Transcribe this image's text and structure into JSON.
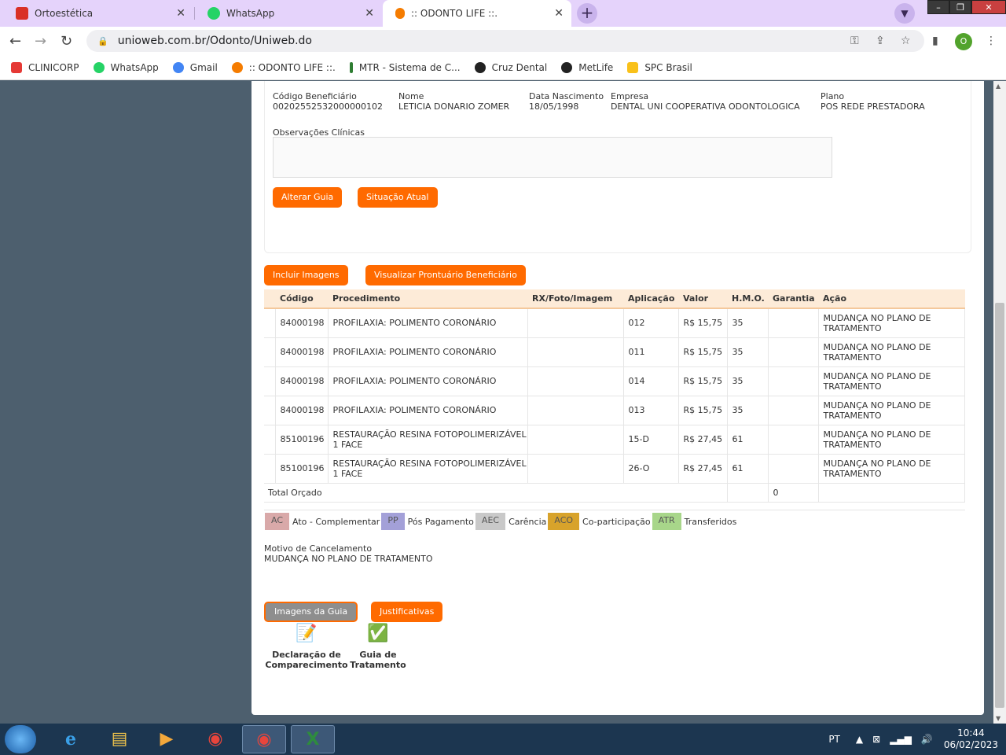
{
  "browser": {
    "tabs": [
      {
        "title": "Ortoestética",
        "favicon_color": "#d93025"
      },
      {
        "title": "WhatsApp",
        "favicon_color": "#25d366"
      },
      {
        "title": ":: ODONTO LIFE ::.",
        "favicon_color": "#f57c00"
      }
    ],
    "url": "unioweb.com.br/Odonto/Uniweb.do",
    "profile_initial": "O",
    "bookmarks": [
      {
        "label": "CLINICORP",
        "icon_color": "#e53935"
      },
      {
        "label": "WhatsApp",
        "icon_color": "#25d366"
      },
      {
        "label": "Gmail",
        "icon_color": "#4285f4"
      },
      {
        "label": ":: ODONTO LIFE ::.",
        "icon_color": "#f57c00"
      },
      {
        "label": "MTR - Sistema de C...",
        "icon_color": "#2e7d32"
      },
      {
        "label": "Cruz Dental",
        "icon_color": "#222222"
      },
      {
        "label": "MetLife",
        "icon_color": "#222222"
      },
      {
        "label": "SPC Brasil",
        "icon_color": "#f9c11a"
      }
    ]
  },
  "beneficiario": {
    "codigo_label": "Código Beneficiário",
    "codigo": "00202552532000000102",
    "nome_label": "Nome",
    "nome": "LETICIA DONARIO ZOMER",
    "nascimento_label": "Data Nascimento",
    "nascimento": "18/05/1998",
    "empresa_label": "Empresa",
    "empresa": "DENTAL UNI COOPERATIVA ODONTOLOGICA",
    "plano_label": "Plano",
    "plano": "POS REDE PRESTADORA",
    "obs_label": "Observações Clínicas",
    "obs_value": ""
  },
  "buttons": {
    "alterar_guia": "Alterar Guia",
    "situacao_atual": "Situação Atual",
    "incluir_imagens": "Incluir Imagens",
    "visualizar_prontuario": "Visualizar Prontuário Beneficiário",
    "imagens_guia": "Imagens da Guia",
    "justificativas": "Justificativas"
  },
  "table": {
    "headers": [
      "Código",
      "Procedimento",
      "RX/Foto/Imagem",
      "Aplicação",
      "Valor",
      "H.M.O.",
      "Garantia",
      "Ação"
    ],
    "rows": [
      {
        "codigo": "84000198",
        "procedimento": "PROFILAXIA: POLIMENTO CORONÁRIO",
        "rx": "",
        "aplicacao": "012",
        "valor": "R$ 15,75",
        "hmo": "35",
        "garantia": "",
        "acao": "MUDANÇA NO PLANO DE TRATAMENTO"
      },
      {
        "codigo": "84000198",
        "procedimento": "PROFILAXIA: POLIMENTO CORONÁRIO",
        "rx": "",
        "aplicacao": "011",
        "valor": "R$ 15,75",
        "hmo": "35",
        "garantia": "",
        "acao": "MUDANÇA NO PLANO DE TRATAMENTO"
      },
      {
        "codigo": "84000198",
        "procedimento": "PROFILAXIA: POLIMENTO CORONÁRIO",
        "rx": "",
        "aplicacao": "014",
        "valor": "R$ 15,75",
        "hmo": "35",
        "garantia": "",
        "acao": "MUDANÇA NO PLANO DE TRATAMENTO"
      },
      {
        "codigo": "84000198",
        "procedimento": "PROFILAXIA: POLIMENTO CORONÁRIO",
        "rx": "",
        "aplicacao": "013",
        "valor": "R$ 15,75",
        "hmo": "35",
        "garantia": "",
        "acao": "MUDANÇA NO PLANO DE TRATAMENTO"
      },
      {
        "codigo": "85100196",
        "procedimento": "RESTAURAÇÃO RESINA FOTOPOLIMERIZÁVEL 1 FACE",
        "rx": "",
        "aplicacao": "15-D",
        "valor": "R$ 27,45",
        "hmo": "61",
        "garantia": "",
        "acao": "MUDANÇA NO PLANO DE TRATAMENTO"
      },
      {
        "codigo": "85100196",
        "procedimento": "RESTAURAÇÃO RESINA FOTOPOLIMERIZÁVEL 1 FACE",
        "rx": "",
        "aplicacao": "26-O",
        "valor": "R$ 27,45",
        "hmo": "61",
        "garantia": "",
        "acao": "MUDANÇA NO PLANO DE TRATAMENTO"
      }
    ],
    "total_label": "Total Orçado",
    "total_valor": "",
    "total_hmo": "0"
  },
  "legend": [
    {
      "code": "AC",
      "label": "Ato - Complementar",
      "color": "#d9a9a9"
    },
    {
      "code": "PP",
      "label": "Pós Pagamento",
      "color": "#a3a0d8"
    },
    {
      "code": "AEC",
      "label": "Carência",
      "color": "#c9c9c9"
    },
    {
      "code": "ACO",
      "label": "Co-participação",
      "color": "#d8a32b"
    },
    {
      "code": "ATR",
      "label": "Transferidos",
      "color": "#a8d68a"
    }
  ],
  "motivo": {
    "label": "Motivo de Cancelamento",
    "value": "MUDANÇA NO PLANO DE TRATAMENTO"
  },
  "documents": [
    {
      "label_line1": "Declaração de",
      "label_line2": "Comparecimento",
      "icon": "document-icon"
    },
    {
      "label_line1": "Guia de",
      "label_line2": "Tratamento",
      "icon": "check-document-icon"
    }
  ],
  "taskbar": {
    "lang": "PT",
    "time": "10:44",
    "date": "06/02/2023"
  }
}
